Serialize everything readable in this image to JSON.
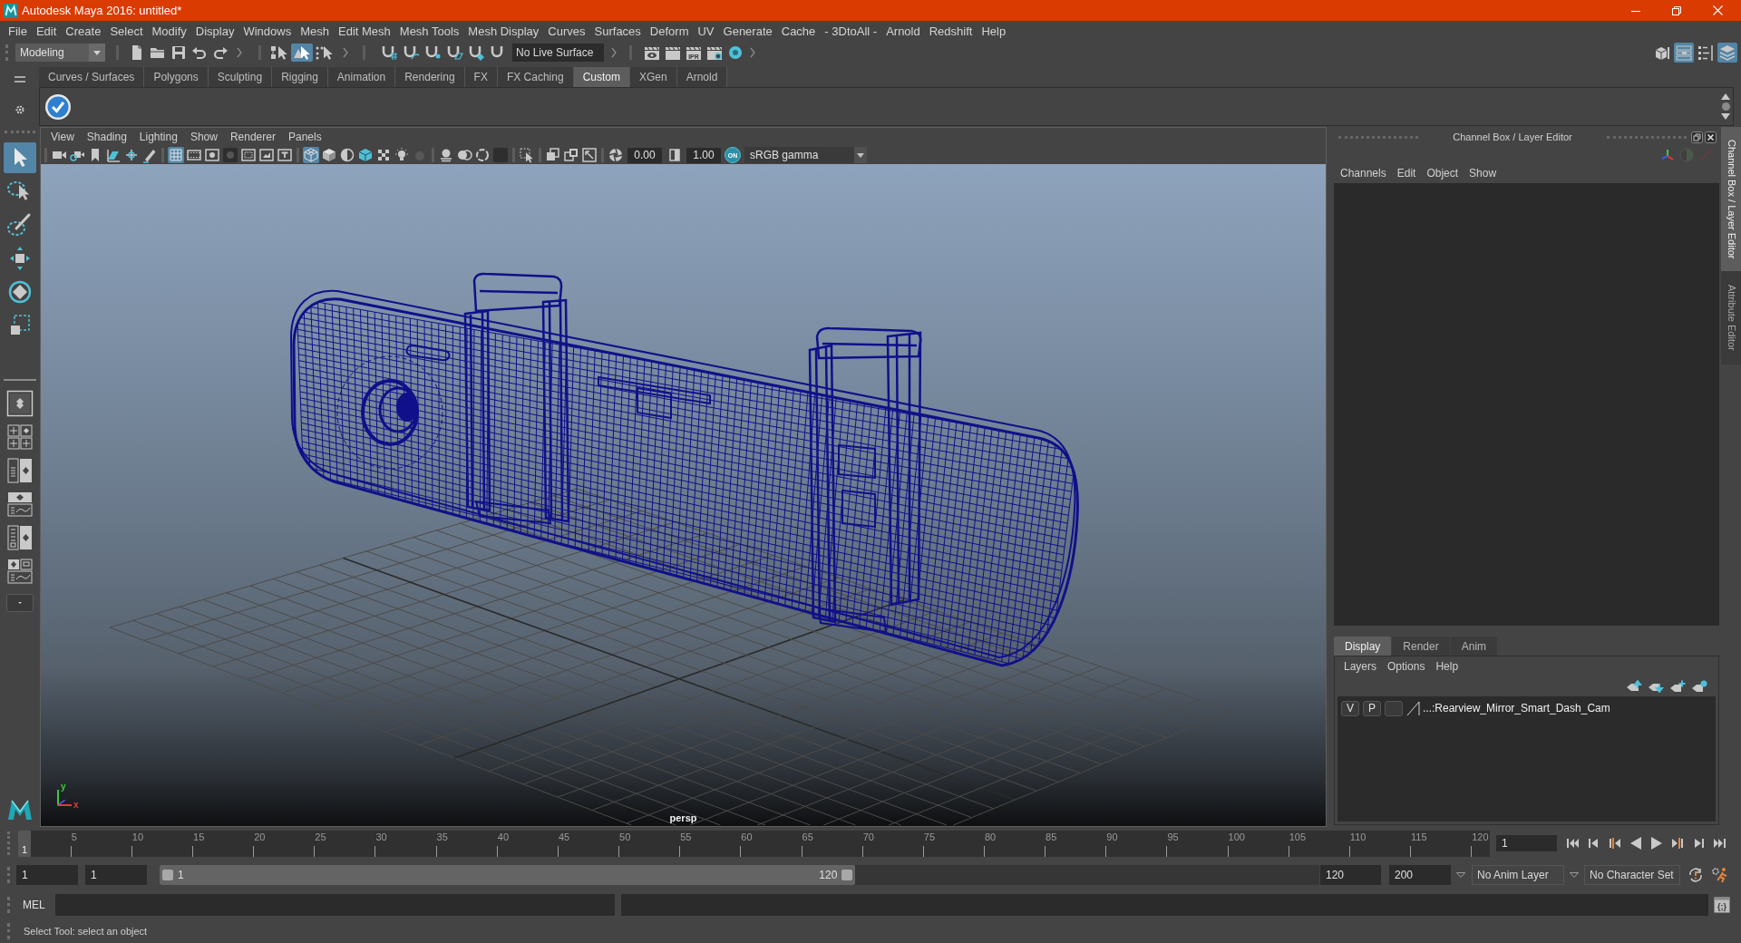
{
  "window": {
    "title": "Autodesk Maya 2016: untitled*"
  },
  "menu_bar": [
    "File",
    "Edit",
    "Create",
    "Select",
    "Modify",
    "Display",
    "Windows",
    "Mesh",
    "Edit Mesh",
    "Mesh Tools",
    "Mesh Display",
    "Curves",
    "Surfaces",
    "Deform",
    "UV",
    "Generate",
    "Cache",
    "- 3DtoAll -",
    "Arnold",
    "Redshift",
    "Help"
  ],
  "status_line": {
    "menu_set": "Modeling",
    "selection_modes": [
      {
        "kind": "hierarchy",
        "selected": false
      },
      {
        "kind": "object",
        "selected": true
      },
      {
        "kind": "component",
        "selected": false
      }
    ],
    "live_surface": "No Live Surface",
    "ipr_label": "IPR",
    "panels": [
      {
        "kind": "modeling_toolkit",
        "selected": false
      },
      {
        "kind": "attribute_editor",
        "selected": true
      },
      {
        "kind": "tool_settings",
        "selected": false
      },
      {
        "kind": "channel_box",
        "selected": true
      }
    ]
  },
  "shelf": {
    "tabs": [
      {
        "label": "Curves / Surfaces",
        "selected": false
      },
      {
        "label": "Polygons",
        "selected": false
      },
      {
        "label": "Sculpting",
        "selected": false
      },
      {
        "label": "Rigging",
        "selected": false
      },
      {
        "label": "Animation",
        "selected": false
      },
      {
        "label": "Rendering",
        "selected": false
      },
      {
        "label": "FX",
        "selected": false
      },
      {
        "label": "FX Caching",
        "selected": false
      },
      {
        "label": "Custom",
        "selected": true
      },
      {
        "label": "XGen",
        "selected": false
      },
      {
        "label": "Arnold",
        "selected": false
      }
    ]
  },
  "toolbox": {
    "tools": [
      {
        "kind": "select",
        "selected": true
      },
      {
        "kind": "lasso",
        "selected": false
      },
      {
        "kind": "paint",
        "selected": false
      },
      {
        "kind": "move",
        "selected": false
      },
      {
        "kind": "rotate",
        "selected": false
      },
      {
        "kind": "scale",
        "selected": false
      }
    ]
  },
  "viewport": {
    "menus": [
      "View",
      "Shading",
      "Lighting",
      "Show",
      "Renderer",
      "Panels"
    ],
    "grid_on": true,
    "wireframe_on": true,
    "exposure": "0.00",
    "gamma": "1.00",
    "color_management": "ON",
    "color_space": "sRGB gamma",
    "camera": "persp",
    "axes": [
      {
        "label": "y",
        "color": "#3ec83e"
      },
      {
        "label": "x",
        "color": "#e03a3a"
      }
    ]
  },
  "channel_box": {
    "title": "Channel Box / Layer Editor",
    "menus": [
      "Channels",
      "Edit",
      "Object",
      "Show"
    ]
  },
  "layer_editor": {
    "tabs": [
      {
        "label": "Display",
        "selected": true
      },
      {
        "label": "Render",
        "selected": false
      },
      {
        "label": "Anim",
        "selected": false
      }
    ],
    "menus": [
      "Layers",
      "Options",
      "Help"
    ],
    "layers": [
      {
        "visible": "V",
        "playback": "P",
        "name": "...:Rearview_Mirror_Smart_Dash_Cam"
      }
    ]
  },
  "side_tabs": [
    {
      "label": "Channel Box / Layer Editor",
      "selected": true
    },
    {
      "label": "Attribute Editor",
      "selected": false
    }
  ],
  "time_slider": {
    "ticks": [
      "5",
      "10",
      "15",
      "20",
      "25",
      "30",
      "35",
      "40",
      "45",
      "50",
      "55",
      "60",
      "65",
      "70",
      "75",
      "80",
      "85",
      "90",
      "95",
      "100",
      "105",
      "110",
      "115",
      "120"
    ],
    "current_frame_marker": "1",
    "level": 0,
    "current_frame": "1"
  },
  "range_slider": {
    "animation_start": "1",
    "playback_start": "1",
    "level": 0.6,
    "range_start": "1",
    "range_end": "120",
    "playback_end": "120",
    "animation_end": "200",
    "anim_layer": "No Anim Layer",
    "character_set": "No Character Set"
  },
  "command_line": {
    "language": "MEL",
    "script_editor_glyph": "{;}"
  },
  "help_line": "Select Tool: select an object"
}
